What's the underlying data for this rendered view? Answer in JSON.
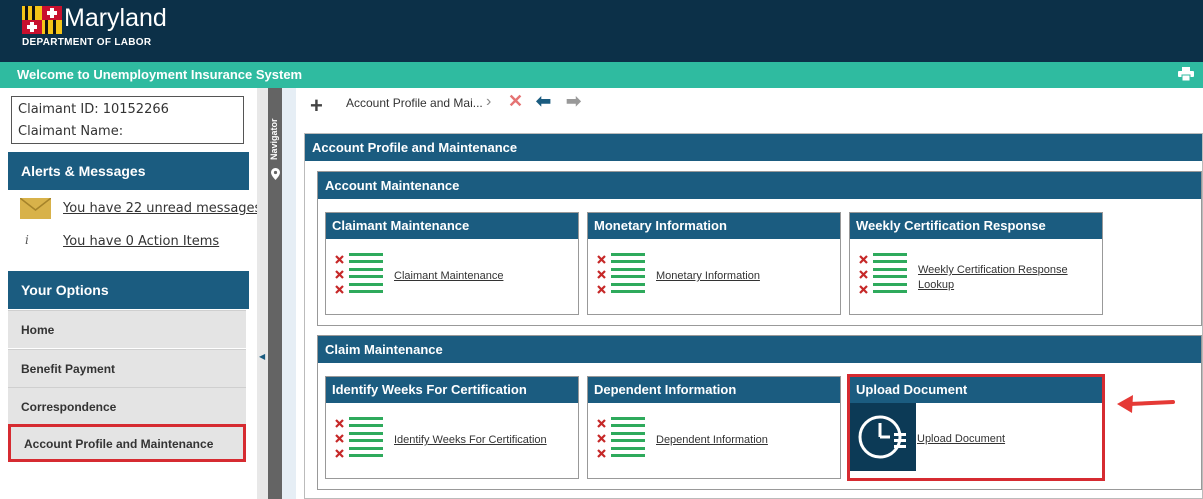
{
  "header": {
    "brand_name": "Maryland",
    "brand_sub": "DEPARTMENT OF LABOR",
    "welcome": "Welcome to Unemployment Insurance System",
    "print_icon": "printer-icon"
  },
  "claimant": {
    "id_line": "Claimant ID: 10152266",
    "name_line": "Claimant Name:"
  },
  "alerts": {
    "title": "Alerts & Messages",
    "messages_link": "You have 22 unread messages",
    "actions_link": "You have 0 Action Items"
  },
  "options": {
    "title": "Your Options",
    "items": [
      {
        "label": "Home"
      },
      {
        "label": "Benefit Payment"
      },
      {
        "label": "Correspondence"
      },
      {
        "label": "Account Profile and Maintenance"
      }
    ]
  },
  "navigator": {
    "label": "Navigator"
  },
  "toolbar": {
    "breadcrumb": "Account Profile and Mai..."
  },
  "main": {
    "title": "Account Profile and Maintenance",
    "account_maintenance": {
      "title": "Account Maintenance",
      "cards": [
        {
          "title": "Claimant Maintenance",
          "link": "Claimant Maintenance"
        },
        {
          "title": "Monetary Information",
          "link": "Monetary Information"
        },
        {
          "title": "Weekly Certification Response",
          "link_l1": "Weekly Certification Response",
          "link_l2": "Lookup"
        }
      ]
    },
    "claim_maintenance": {
      "title": "Claim Maintenance",
      "cards": [
        {
          "title": "Identify Weeks For Certification",
          "link": "Identify Weeks For Certification"
        },
        {
          "title": "Dependent Information",
          "link": "Dependent Information"
        },
        {
          "title": "Upload Document",
          "link": "Upload Document"
        }
      ]
    }
  },
  "colors": {
    "header_bg": "#0c3048",
    "welcome_bg": "#2fbba0",
    "panel_blue": "#1b5c80",
    "highlight_red": "#d62b31",
    "list_green": "#2eaa5c",
    "x_red": "#c62828"
  }
}
